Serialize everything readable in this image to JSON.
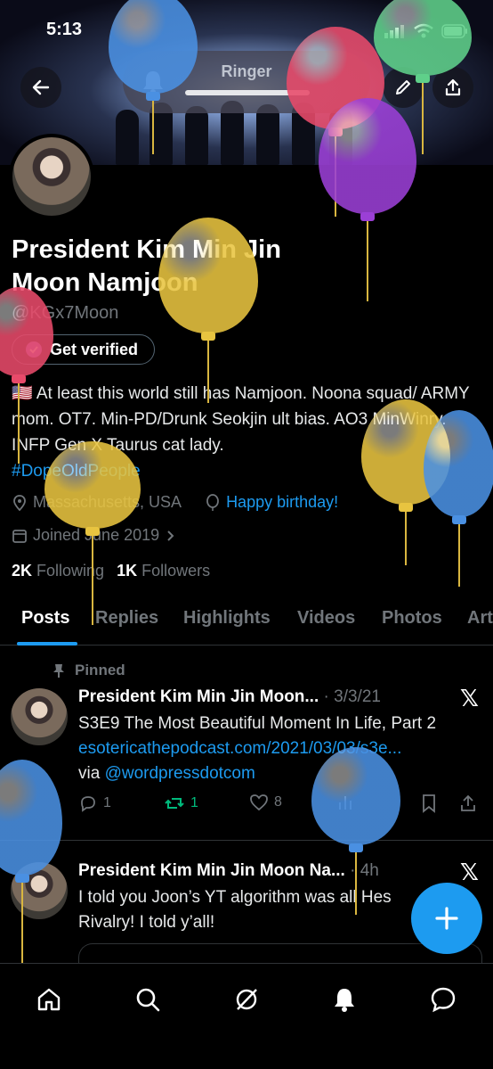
{
  "status_bar": {
    "time": "5:13"
  },
  "ringer": {
    "label": "Ringer"
  },
  "profile": {
    "name": "President Kim Min Jin Moon Namjoon",
    "handle": "@KGx7Moon",
    "get_verified_label": "Get verified",
    "bio_text": "🇺🇸 At least this world still has Namjoon. Noona squad/ ARMY mom. OT7. Min-PD/Drunk Seokjin ult bias. AO3 MinWinry. INFP Gen X Taurus cat lady.",
    "bio_hashtag": "#DopeOldPeople",
    "location": "Massachusetts, USA",
    "birthday": "Happy birthday!",
    "joined": "Joined June 2019",
    "following_count": "2K",
    "following_label": "Following",
    "followers_count": "1K",
    "followers_label": "Followers"
  },
  "tabs": [
    {
      "label": "Posts"
    },
    {
      "label": "Replies"
    },
    {
      "label": "Highlights"
    },
    {
      "label": "Videos"
    },
    {
      "label": "Photos"
    },
    {
      "label": "Art"
    }
  ],
  "posts": [
    {
      "pinned_label": "Pinned",
      "author": "President Kim Min Jin Moon...",
      "date": "· 3/3/21",
      "line1": "S3E9 The Most Beautiful Moment In Life, Part 2",
      "link": "esotericathepodcast.com/2021/03/03/s3e...",
      "via": "via",
      "mention": "@wordpressdotcom",
      "replies": "1",
      "reposts": "1",
      "likes": "8"
    },
    {
      "author": "President Kim Min Jin Moon Na...",
      "date": "· 4h",
      "text": "I told you Joon’s YT algorithm was all Hes Rivalry! I told y’all!"
    }
  ],
  "icons": {
    "back": "back-arrow-icon",
    "edit": "pencil-icon",
    "share": "share-icon",
    "bell": "bell-icon",
    "x": "x-logo-icon",
    "compose": "plus-icon"
  },
  "colors": {
    "accent": "#1d9bf0",
    "repost_active": "#00ba7c",
    "balloon_blue": "#4a90e2",
    "balloon_yellow": "#e8c440",
    "balloon_red": "#e84a6a",
    "balloon_purple": "#9b3fd6",
    "balloon_green": "#5fd08a"
  }
}
